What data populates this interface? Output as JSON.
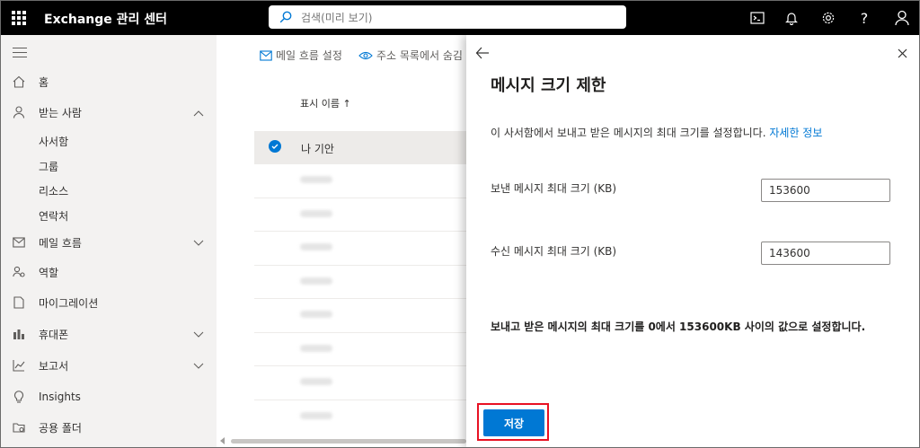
{
  "app": {
    "title": "Exchange 관리 센터"
  },
  "search": {
    "placeholder": "검색(미리 보기)"
  },
  "sidebar": {
    "items": [
      {
        "label": "홈"
      },
      {
        "label": "받는 사람",
        "subitems": [
          "사서함",
          "그룹",
          "리소스",
          "연락처"
        ]
      },
      {
        "label": "메일 흐름"
      },
      {
        "label": "역할"
      },
      {
        "label": "마이그레이션"
      },
      {
        "label": "휴대폰"
      },
      {
        "label": "보고서"
      },
      {
        "label": "Insights"
      },
      {
        "label": "공용 폴더"
      }
    ]
  },
  "list": {
    "commands": [
      "메일 흐름 설정",
      "주소 목록에서 숨김"
    ],
    "column_header": "표시 이름 ↑",
    "selected_row": "나 기안"
  },
  "panel": {
    "title": "메시지 크기 제한",
    "description": "이 사서함에서 보내고 받은 메시지의 최대 크기를 설정합니다.",
    "learn_more": "자세한 정보",
    "send_label": "보낸 메시지 최대 크기 (KB)",
    "send_value": "153600",
    "receive_label": "수신 메시지 최대 크기 (KB)",
    "receive_value": "143600",
    "note": "보내고 받은 메시지의 최대 크기를 0에서 153600KB 사이의 값으로 설정합니다.",
    "save_label": "저장"
  },
  "colors": {
    "accent": "#0078d4",
    "highlight": "#e81123",
    "topbar": "#000000",
    "sidebar": "#f3f2f1"
  }
}
